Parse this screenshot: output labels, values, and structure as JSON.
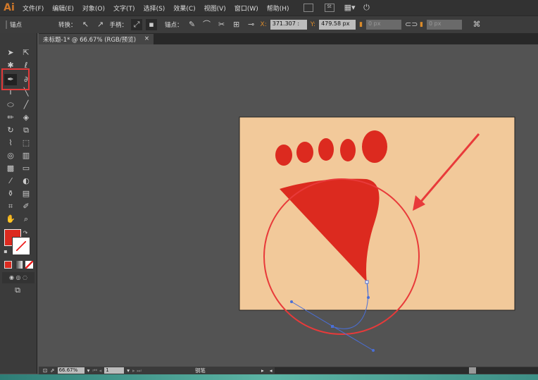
{
  "app": {
    "logo": "Ai"
  },
  "menu": [
    "文件(F)",
    "编辑(E)",
    "对象(O)",
    "文字(T)",
    "选择(S)",
    "效果(C)",
    "视图(V)",
    "窗口(W)",
    "帮助(H)"
  ],
  "menu_icons": [
    "bridge-icon",
    "stock-icon",
    "arrange-documents-icon",
    "sync-icon"
  ],
  "menu_icon_st": "St",
  "control": {
    "anchor_label": "锚点",
    "convert_label": "转换：",
    "handles_label": "手柄：",
    "anchors_label": "锚点：",
    "x_label": "X:",
    "x_value": "371.307 :",
    "y_label": "Y:",
    "y_value": "479.58 px",
    "w_value": "0 px",
    "h_value": "0 px"
  },
  "tab": {
    "title": "未标题-1* @ 66.67% (RGB/预览)",
    "close": "×"
  },
  "status": {
    "zoom": "66.67%",
    "page": "1",
    "tool": "钢笔"
  },
  "colors": {
    "fill": "#dc2a1f",
    "artboard": "#f2c99a",
    "annotation": "#e83a3a",
    "path": "#4a6fd8"
  }
}
